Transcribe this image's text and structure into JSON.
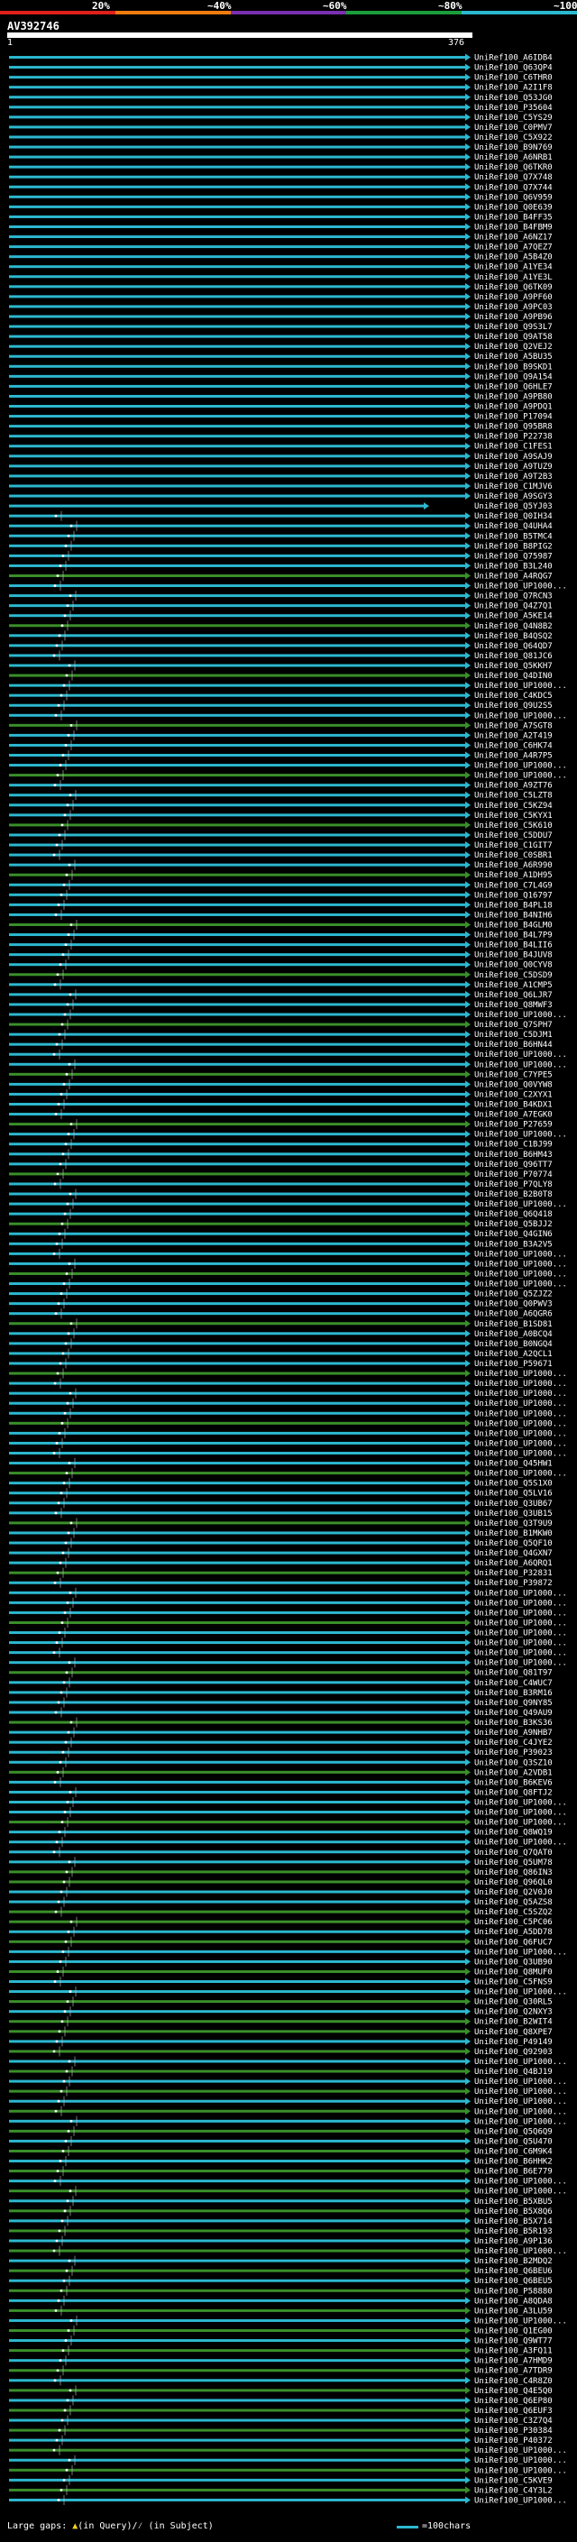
{
  "header": {
    "legend": [
      "20%",
      "~40%",
      "~60%",
      "~80%",
      "~100%"
    ],
    "legend_colors": [
      "#e0201a",
      "#f07c10",
      "#7a2fb0",
      "#1a9e3a",
      "#2cb8d0"
    ]
  },
  "query": {
    "title": "AV392746",
    "start": "1",
    "end": "376"
  },
  "colors": {
    "high": "#2cb8d0",
    "mid": "#3a8f2a",
    "line": "#c8c8c8"
  },
  "hits": [
    "UniRef100_A6IDB4",
    "UniRef100_Q63QP4",
    "UniRef100_C6THR0",
    "UniRef100_A2I1F8",
    "UniRef100_Q53JG0",
    "UniRef100_P35604",
    "UniRef100_C5YS29",
    "UniRef100_C0PMV7",
    "UniRef100_C5X922",
    "UniRef100_B9N769",
    "UniRef100_A6NRB1",
    "UniRef100_Q6TKR0",
    "UniRef100_Q7X748",
    "UniRef100_Q7X744",
    "UniRef100_Q6V959",
    "UniRef100_Q0E639",
    "UniRef100_B4FF35",
    "UniRef100_B4FBM9",
    "UniRef100_A6NZ17",
    "UniRef100_A7QEZ7",
    "UniRef100_A5B4Z0",
    "UniRef100_A1YE34",
    "UniRef100_A1YE3L",
    "UniRef100_Q6TK09",
    "UniRef100_A9PF60",
    "UniRef100_A9PC03",
    "UniRef100_A9PB96",
    "UniRef100_Q9S3L7",
    "UniRef100_Q9AT58",
    "UniRef100_Q2VEJ2",
    "UniRef100_A5BU35",
    "UniRef100_B9SKD1",
    "UniRef100_Q9A154",
    "UniRef100_Q6HLE7",
    "UniRef100_A9PB80",
    "UniRef100_A9PDQ1",
    "UniRef100_P17094",
    "UniRef100_Q95BR8",
    "UniRef100_P22738",
    "UniRef100_C1FES1",
    "UniRef100_A9SAJ9",
    "UniRef100_A9TUZ9",
    "UniRef100_A9T2B3",
    "UniRef100_C1MJV6",
    "UniRef100_A9SGY3",
    "UniRef100_Q5YJ03",
    "UniRef100_Q0IH34",
    "UniRef100_Q4UHA4",
    "UniRef100_B5TMC4",
    "UniRef100_B8PIG2",
    "UniRef100_Q75987",
    "UniRef100_B3L240",
    "UniRef100_A4RQG7",
    "UniRef100_UP1000...",
    "UniRef100_Q7RCN3",
    "UniRef100_Q4Z7Q1",
    "UniRef100_A5KE14",
    "UniRef100_Q4N8B2",
    "UniRef100_B4QSQ2",
    "UniRef100_Q64QD7",
    "UniRef100_Q81JC6",
    "UniRef100_Q5KKH7",
    "UniRef100_Q4DIN0",
    "UniRef100_UP1000...",
    "UniRef100_C4KDC5",
    "UniRef100_Q9U2S5",
    "UniRef100_UP1000...",
    "UniRef100_A7SGT8",
    "UniRef100_A2T419",
    "UniRef100_C6HK74",
    "UniRef100_A4R7P5",
    "UniRef100_UP1000...",
    "UniRef100_UP1000...",
    "UniRef100_A9ZT76",
    "UniRef100_C5LZT8",
    "UniRef100_C5KZ94",
    "UniRef100_C5KYX1",
    "UniRef100_C5K610",
    "UniRef100_C5DDU7",
    "UniRef100_C1GIT7",
    "UniRef100_C0SBR1",
    "UniRef100_A6R990",
    "UniRef100_A1DH95",
    "UniRef100_C7L4G9",
    "UniRef100_Q16797",
    "UniRef100_B4PL18",
    "UniRef100_B4NIH6",
    "UniRef100_B4GLM0",
    "UniRef100_B4L7P9",
    "UniRef100_B4LII6",
    "UniRef100_B4JUV8",
    "UniRef100_Q0CYV8",
    "UniRef100_C5DSD9",
    "UniRef100_A1CMP5",
    "UniRef100_Q6LJR7",
    "UniRef100_Q8MWF3",
    "UniRef100_UP1000...",
    "UniRef100_Q7SPH7",
    "UniRef100_C5DJM1",
    "UniRef100_B6HN44",
    "UniRef100_UP1000...",
    "UniRef100_UP1000...",
    "UniRef100_C7YPE5",
    "UniRef100_Q0VYW8",
    "UniRef100_C2XYX1",
    "UniRef100_B4KDX1",
    "UniRef100_A7EGK0",
    "UniRef100_P27659",
    "UniRef100_UP1000...",
    "UniRef100_C1BJ99",
    "UniRef100_B6HM43",
    "UniRef100_Q96TT7",
    "UniRef100_P70774",
    "UniRef100_P7QLY8",
    "UniRef100_B2B0T8",
    "UniRef100_UP1000...",
    "UniRef100_Q6Q418",
    "UniRef100_Q5BJJ2",
    "UniRef100_Q4GIN6",
    "UniRef100_B3A2V5",
    "UniRef100_UP1000...",
    "UniRef100_UP1000...",
    "UniRef100_UP1000...",
    "UniRef100_UP1000...",
    "UniRef100_Q5ZJZ2",
    "UniRef100_Q0PWV3",
    "UniRef100_A6QGR6",
    "UniRef100_B1SD81",
    "UniRef100_A0BCQ4",
    "UniRef100_B0NGQ4",
    "UniRef100_A2QCL1",
    "UniRef100_P59671",
    "UniRef100_UP1000...",
    "UniRef100_UP1000...",
    "UniRef100_UP1000...",
    "UniRef100_UP1000...",
    "UniRef100_UP1000...",
    "UniRef100_UP1000...",
    "UniRef100_UP1000...",
    "UniRef100_UP1000...",
    "UniRef100_UP1000...",
    "UniRef100_Q45HW1",
    "UniRef100_UP1000...",
    "UniRef100_Q5S1X0",
    "UniRef100_Q5LV16",
    "UniRef100_Q3UB67",
    "UniRef100_Q3UB15",
    "UniRef100_Q3T9U9",
    "UniRef100_B1MKW0",
    "UniRef100_Q5QF10",
    "UniRef100_Q4GXN7",
    "UniRef100_A6QRQ1",
    "UniRef100_P32831",
    "UniRef100_P39872",
    "UniRef100_UP1000...",
    "UniRef100_UP1000...",
    "UniRef100_UP1000...",
    "UniRef100_UP1000...",
    "UniRef100_UP1000...",
    "UniRef100_UP1000...",
    "UniRef100_UP1000...",
    "UniRef100_UP1000...",
    "UniRef100_Q81T97",
    "UniRef100_C4WUC7",
    "UniRef100_B3RM16",
    "UniRef100_Q9NY85",
    "UniRef100_Q49AU9",
    "UniRef100_B3KS36",
    "UniRef100_A9NHB7",
    "UniRef100_C4JYE2",
    "UniRef100_P39023",
    "UniRef100_Q3SZ10",
    "UniRef100_A2VDB1",
    "UniRef100_B6KEV6",
    "UniRef100_Q8FTJ2",
    "UniRef100_UP1000...",
    "UniRef100_UP1000...",
    "UniRef100_UP1000...",
    "UniRef100_Q8WQ19",
    "UniRef100_UP1000...",
    "UniRef100_Q7QAT0",
    "UniRef100_Q5UM78",
    "UniRef100_Q86IN3",
    "UniRef100_Q96QL0",
    "UniRef100_Q2V0J0",
    "UniRef100_Q5AZS8",
    "UniRef100_C5SZQ2",
    "UniRef100_C5PC06",
    "UniRef100_A5DD78",
    "UniRef100_Q6FUC7",
    "UniRef100_UP1000...",
    "UniRef100_Q3UB90",
    "UniRef100_Q8MUF0",
    "UniRef100_C5FNS9",
    "UniRef100_UP1000...",
    "UniRef100_Q30RL5",
    "UniRef100_Q2NXY3",
    "UniRef100_B2WIT4",
    "UniRef100_Q8XPE7",
    "UniRef100_P49149",
    "UniRef100_Q92903",
    "UniRef100_UP1000...",
    "UniRef100_Q4BJ19",
    "UniRef100_UP1000...",
    "UniRef100_UP1000...",
    "UniRef100_UP1000...",
    "UniRef100_UP1000...",
    "UniRef100_UP1000...",
    "UniRef100_Q5Q6Q9",
    "UniRef100_Q5U470",
    "UniRef100_C6M9K4",
    "UniRef100_B6HHK2",
    "UniRef100_B6E779",
    "UniRef100_UP1000...",
    "UniRef100_UP1000...",
    "UniRef100_B5XBU5",
    "UniRef100_B5X8Q6",
    "UniRef100_B5X714",
    "UniRef100_B5R193",
    "UniRef100_A9P136",
    "UniRef100_UP1000...",
    "UniRef100_B2MDQ2",
    "UniRef100_Q6BEU6",
    "UniRef100_Q6BEU5",
    "UniRef100_P58880",
    "UniRef100_A8QDA8",
    "UniRef100_A3LU59",
    "UniRef100_UP1000...",
    "UniRef100_Q1EG00",
    "UniRef100_Q9WT77",
    "UniRef100_A3FQ11",
    "UniRef100_A7HMD9",
    "UniRef100_A7TDR9",
    "UniRef100_C4R8Z0",
    "UniRef100_Q4E5Q0",
    "UniRef100_Q6EP80",
    "UniRef100_Q6EUF3",
    "UniRef100_C3Z7Q4",
    "UniRef100_P30384",
    "UniRef100_P40372",
    "UniRef100_UP1000...",
    "UniRef100_UP1000...",
    "UniRef100_UP1000...",
    "UniRef100_C5KVE9",
    "UniRef100_C4Y3L2",
    "UniRef100_UP1000..."
  ],
  "footer": {
    "large_gaps": "Large gaps: ",
    "in_query": "(in Query)/",
    "in_subject": " (in Subject)",
    "scale": "=100chars"
  }
}
